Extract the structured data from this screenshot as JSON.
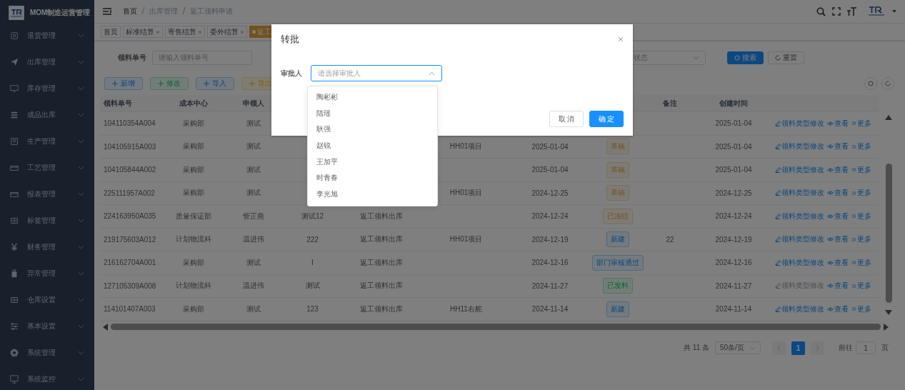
{
  "sidebar": {
    "title": "MOM制造运营管理",
    "items": [
      {
        "label": "退货管理"
      },
      {
        "label": "出库管理"
      },
      {
        "label": "库存管理"
      },
      {
        "label": "成品出库"
      },
      {
        "label": "生产管理"
      },
      {
        "label": "工艺管理"
      },
      {
        "label": "报表管理"
      },
      {
        "label": "标签管理"
      },
      {
        "label": "财务管理"
      },
      {
        "label": "异常管理"
      },
      {
        "label": "仓库设置"
      },
      {
        "label": "基本设置"
      },
      {
        "label": "系统管理"
      },
      {
        "label": "系统监控"
      }
    ]
  },
  "breadcrumb": [
    "首页",
    "出库管理",
    "返工领料申请"
  ],
  "tags": [
    {
      "label": "首页",
      "closable": false,
      "selected": false
    },
    {
      "label": "标准结算",
      "closable": true,
      "selected": false
    },
    {
      "label": "寄售结算",
      "closable": true,
      "selected": false
    },
    {
      "label": "委外结算",
      "closable": true,
      "selected": false
    },
    {
      "label": "返工",
      "closable": false,
      "selected": true
    }
  ],
  "search": {
    "label": "领料单号",
    "placeholder": "请输入领料单号",
    "status_placeholder": "状态",
    "search_button": "搜索",
    "reset_button": "重置"
  },
  "toolbar": [
    {
      "label": "新增",
      "kind": "primary"
    },
    {
      "label": "修改",
      "kind": "success"
    },
    {
      "label": "导入",
      "kind": "primary"
    },
    {
      "label": "导出",
      "kind": "warning"
    }
  ],
  "table": {
    "columns": [
      "领料单号",
      "成本中心",
      "申领人",
      null,
      null,
      null,
      null,
      null,
      "备注",
      "创建时间",
      null
    ],
    "rows": [
      {
        "cells": [
          "104110354A004",
          "采购部",
          "测试",
          null,
          null,
          null,
          null,
          null,
          null,
          "2025-01-04"
        ],
        "status": null,
        "edit_disabled": false,
        "actions": [
          "领料类型修改",
          "查看",
          "更多"
        ]
      },
      {
        "cells": [
          "104105915A003",
          "采购部",
          "测试",
          null,
          null,
          "HH01项目",
          "2025-01-04",
          null,
          null,
          "2025-01-04"
        ],
        "status": {
          "label": "草稿",
          "kind": "warning"
        },
        "edit_disabled": false,
        "actions": [
          "领料类型修改",
          "查看",
          "更多"
        ]
      },
      {
        "cells": [
          "104105844A002",
          "采购部",
          "测试",
          null,
          null,
          null,
          "2025-01-04",
          null,
          null,
          "2025-01-04"
        ],
        "status": {
          "label": "草稿",
          "kind": "warning"
        },
        "edit_disabled": false,
        "actions": [
          "领料类型修改",
          "查看",
          "更多"
        ]
      },
      {
        "cells": [
          "225111957A002",
          "采购部",
          "测试",
          null,
          null,
          "HH01项目",
          "2024-12-25",
          null,
          null,
          "2024-12-25"
        ],
        "status": {
          "label": "草稿",
          "kind": "warning"
        },
        "edit_disabled": false,
        "actions": [
          "领料类型修改",
          "查看",
          "更多"
        ]
      },
      {
        "cells": [
          "224163950A035",
          "质量保证部",
          "訾正燕",
          "测试12",
          "返工领料出库",
          null,
          "2024-12-24",
          null,
          null,
          "2024-12-24"
        ],
        "status": {
          "label": "已冻结",
          "kind": "warning"
        },
        "edit_disabled": false,
        "actions": [
          "领料类型修改",
          "查看",
          "更多"
        ]
      },
      {
        "cells": [
          "219175603A012",
          "计划物流科",
          "温进伟",
          "222",
          "返工领料出库",
          "HH01项目",
          "2024-12-19",
          null,
          "22",
          "2024-12-19"
        ],
        "status": {
          "label": "新建",
          "kind": "primary"
        },
        "edit_disabled": false,
        "actions": [
          "领料类型修改",
          "查看",
          "更多"
        ]
      },
      {
        "cells": [
          "216162704A001",
          "采购部",
          "测试",
          "I",
          "返工领料出库",
          null,
          "2024-12-16",
          null,
          null,
          "2024-12-16"
        ],
        "status": {
          "label": "部门审核通过",
          "kind": "primary"
        },
        "edit_disabled": false,
        "actions": [
          "领料类型修改",
          "查看",
          "更多"
        ]
      },
      {
        "cells": [
          "127105309A008",
          "计划物流科",
          "温进伟",
          "测试",
          "返工领料出库",
          null,
          "2024-11-27",
          null,
          null,
          "2024-11-27"
        ],
        "status": {
          "label": "已发料",
          "kind": "success"
        },
        "edit_disabled": true,
        "actions": [
          "领料类型修改",
          "查看",
          "更多"
        ]
      },
      {
        "cells": [
          "114101407A003",
          "采购部",
          "测试",
          "123",
          "返工领料出库",
          "HH11右舵",
          "2024-11-14",
          null,
          null,
          "2024-11-14"
        ],
        "status": {
          "label": "新建",
          "kind": "primary"
        },
        "edit_disabled": false,
        "actions": [
          "领料类型修改",
          "查看",
          "更多"
        ]
      }
    ]
  },
  "pagination": {
    "total": "共 11 条",
    "page_size": "50条/页",
    "pages": [
      {
        "label": "1",
        "selected": true
      }
    ],
    "goto_label": "前往",
    "goto_value": "1",
    "goto_suffix": "页"
  },
  "dialog": {
    "title": "转批",
    "field_label": "审批人",
    "placeholder": "请选择审批人",
    "open": true,
    "options": [
      {
        "label": "陶彬彬",
        "selected": false
      },
      {
        "label": "陆瑶",
        "selected": false
      },
      {
        "label": "耿强",
        "selected": false
      },
      {
        "label": "赵锐",
        "selected": false
      },
      {
        "label": "王加平",
        "selected": false
      },
      {
        "label": "时青春",
        "selected": false
      },
      {
        "label": "李光旭",
        "selected": false
      }
    ],
    "cancel": "取 消",
    "confirm": "确 定"
  }
}
